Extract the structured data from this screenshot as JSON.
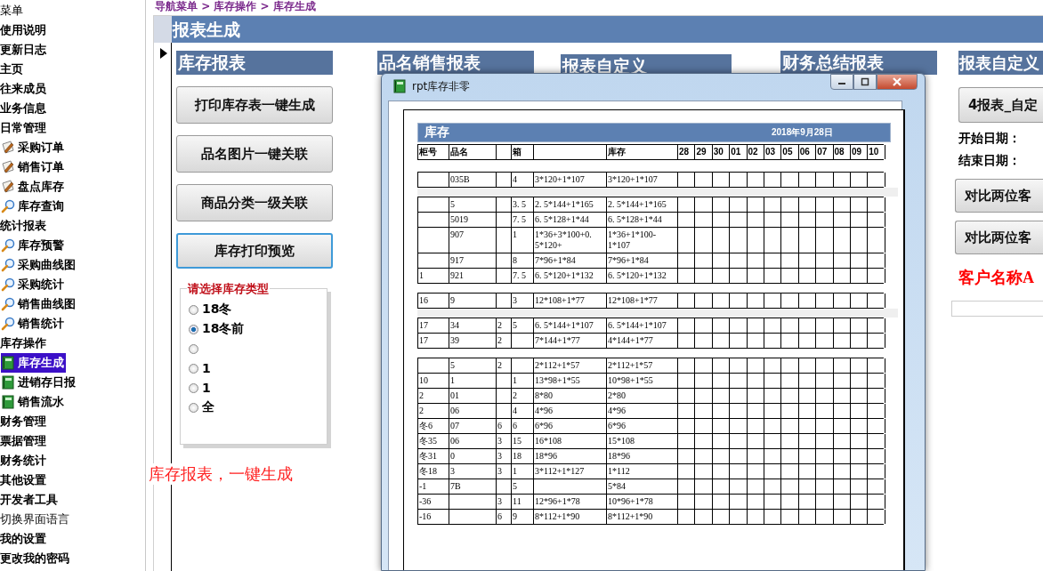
{
  "sidebar": {
    "items": [
      {
        "label": "菜单",
        "kind": "plain",
        "selected": false
      },
      {
        "label": "使用说明",
        "kind": "group",
        "selected": false
      },
      {
        "label": "更新日志",
        "kind": "group",
        "selected": false
      },
      {
        "label": "主页",
        "kind": "group",
        "selected": false
      },
      {
        "label": "往来成员",
        "kind": "group",
        "selected": false
      },
      {
        "label": "业务信息",
        "kind": "group",
        "selected": false
      },
      {
        "label": "日常管理",
        "kind": "group",
        "selected": false,
        "children": [
          {
            "label": "采购订单",
            "kind": "pencil",
            "selected": false
          },
          {
            "label": "销售订单",
            "kind": "pencil",
            "selected": false
          },
          {
            "label": "盘点库存",
            "kind": "pencil",
            "selected": false
          },
          {
            "label": "库存查询",
            "kind": "search",
            "selected": false
          }
        ]
      },
      {
        "label": "统计报表",
        "kind": "group",
        "selected": false,
        "children": [
          {
            "label": "库存预警",
            "kind": "search",
            "selected": false
          },
          {
            "label": "采购曲线图",
            "kind": "search",
            "selected": false
          },
          {
            "label": "采购统计",
            "kind": "search",
            "selected": false
          },
          {
            "label": "销售曲线图",
            "kind": "search",
            "selected": false
          },
          {
            "label": "销售统计",
            "kind": "search",
            "selected": false
          }
        ]
      },
      {
        "label": "库存操作",
        "kind": "group",
        "selected": false,
        "children": [
          {
            "label": "库存生成",
            "kind": "book",
            "selected": true
          },
          {
            "label": "进销存日报",
            "kind": "book",
            "selected": false
          },
          {
            "label": "销售流水",
            "kind": "book",
            "selected": false
          }
        ]
      },
      {
        "label": "财务管理",
        "kind": "group",
        "selected": false
      },
      {
        "label": "票据管理",
        "kind": "group",
        "selected": false
      },
      {
        "label": "财务统计",
        "kind": "group",
        "selected": false
      },
      {
        "label": "其他设置",
        "kind": "group",
        "selected": false
      },
      {
        "label": "开发者工具",
        "kind": "group",
        "selected": false
      },
      {
        "label": "切换界面语言",
        "kind": "plain",
        "selected": false
      },
      {
        "label": "我的设置",
        "kind": "group",
        "selected": false
      },
      {
        "label": "更改我的密码",
        "kind": "group",
        "selected": false
      }
    ]
  },
  "breadcrumb": "导航菜单 > 库存操作 > 库存生成",
  "form": {
    "title": "报表生成",
    "sections": [
      {
        "title": "库存报表",
        "kind": "stock",
        "buttons": [
          {
            "label": "打印库存表一键生成",
            "focused": false
          },
          {
            "label": "品名图片一键关联",
            "focused": false
          },
          {
            "label": "商品分类一级关联",
            "focused": false
          },
          {
            "label": "库存打印预览",
            "focused": true
          }
        ],
        "radio_group": {
          "legend": "请选择库存类型",
          "options": [
            {
              "label": "18冬",
              "selected": false
            },
            {
              "label": "18冬前",
              "selected": true
            },
            {
              "selected": false
            },
            {
              "label": "1",
              "selected": false
            },
            {
              "label": "1",
              "selected": false
            },
            {
              "label": "全",
              "selected": false
            }
          ]
        }
      },
      {
        "title": "品名销售报表",
        "kind": "hidden"
      },
      {
        "title": "报表自定义",
        "kind": "hidden"
      },
      {
        "title": "财务总结报表",
        "kind": "hidden"
      },
      {
        "title": "报表自定义",
        "kind": "custom",
        "buttons": [
          {
            "label": "4报表_自定",
            "focused": false
          }
        ],
        "start_label": "开始日期：",
        "end_label": "结束日期：",
        "compare_buttons": [
          "对比两位客",
          "对比两位客"
        ],
        "customer_label": "客户名称A"
      }
    ]
  },
  "annotation": "库存报表，一键生成",
  "preview_window": {
    "title": "rpt库存非零",
    "report": {
      "title": "库存",
      "date": "2018年9月28日",
      "columns": [
        "柜号",
        "品名",
        null,
        "箱",
        null,
        "库存",
        "28",
        "29",
        "30",
        "01",
        "02",
        "03",
        "05",
        "06",
        "07",
        "08",
        "09",
        "10"
      ],
      "groups": [
        {
          "shaded_separator_after": true,
          "rows": [
            {
              "name": "035B",
              "boxes": "4",
              "column_5": "3*120+1*107",
              "stock": "3*120+1*107"
            }
          ]
        },
        {
          "shaded_separator_after": false,
          "rows": [
            {
              "name": "5",
              "boxes": "3. 5",
              "column_5": "2. 5*144+1*165",
              "stock": "2. 5*144+1*165"
            },
            {
              "name": "5019",
              "boxes": "7. 5",
              "column_5": "6. 5*128+1*44",
              "stock": "6. 5*128+1*44"
            },
            {
              "name": "907",
              "boxes": "1",
              "column_5": "1*36+3*100+0. 5*120+",
              "stock": "1*36+1*100-1*107"
            },
            {
              "name": "917",
              "boxes": "8",
              "column_5": "7*96+1*84",
              "stock": "7*96+1*84"
            },
            {
              "cabinet_no": "1",
              "name": "921",
              "boxes": "7. 5",
              "column_5": "6. 5*120+1*132",
              "stock": "6. 5*120+1*132"
            }
          ]
        },
        {
          "shaded_separator_after": true,
          "rows": [
            {
              "cabinet_no": "16",
              "name": "9",
              "boxes": "3",
              "column_5": "12*108+1*77",
              "stock": "12*108+1*77"
            }
          ]
        },
        {
          "shaded_separator_after": false,
          "rows": [
            {
              "cabinet_no": "17",
              "name": "34",
              "column_3": "2",
              "boxes": "5",
              "column_5": "6. 5*144+1*107",
              "stock": "6. 5*144+1*107"
            },
            {
              "cabinet_no": "17",
              "name": "39",
              "column_3": "2",
              "column_5": "7*144+1*77",
              "stock": "4*144+1*77"
            }
          ]
        },
        {
          "rows": [
            {
              "name": "5",
              "column_3": "2",
              "column_5": "2*112+1*57",
              "stock": "2*112+1*57"
            },
            {
              "cabinet_no": "10",
              "name": "1",
              "boxes": "1",
              "column_5": "13*98+1*55",
              "stock": "10*98+1*55"
            },
            {
              "cabinet_no": "2",
              "name": "01",
              "boxes": "2",
              "column_5": "8*80",
              "stock": "2*80"
            },
            {
              "cabinet_no": "2",
              "name": "06",
              "boxes": "4",
              "column_5": "4*96",
              "stock": "4*96"
            },
            {
              "cabinet_no": "冬6",
              "name": "07",
              "column_3": "6",
              "boxes": "6",
              "column_5": "6*96",
              "stock": "6*96"
            },
            {
              "cabinet_no": "冬35",
              "name": "06",
              "column_3": "3",
              "boxes": "15",
              "column_5": "16*108",
              "stock": "15*108"
            },
            {
              "cabinet_no": "冬31",
              "name": "0",
              "column_3": "3",
              "boxes": "18",
              "column_5": "18*96",
              "stock": "18*96"
            },
            {
              "cabinet_no": "冬18",
              "name": "3",
              "column_3": "3",
              "boxes": "1",
              "column_5": "3*112+1*127",
              "stock": "1*112"
            },
            {
              "cabinet_no": "-1",
              "name": "7B",
              "boxes": "5",
              "stock": "5*84"
            },
            {
              "cabinet_no": "-36",
              "column_3": "3",
              "boxes": "11",
              "column_5": "12*96+1*78",
              "stock": "10*96+1*78"
            },
            {
              "cabinet_no": "-16",
              "column_3": "6",
              "boxes": "9",
              "column_5": "8*112+1*90",
              "stock": "8*112+1*90"
            }
          ]
        }
      ]
    }
  }
}
